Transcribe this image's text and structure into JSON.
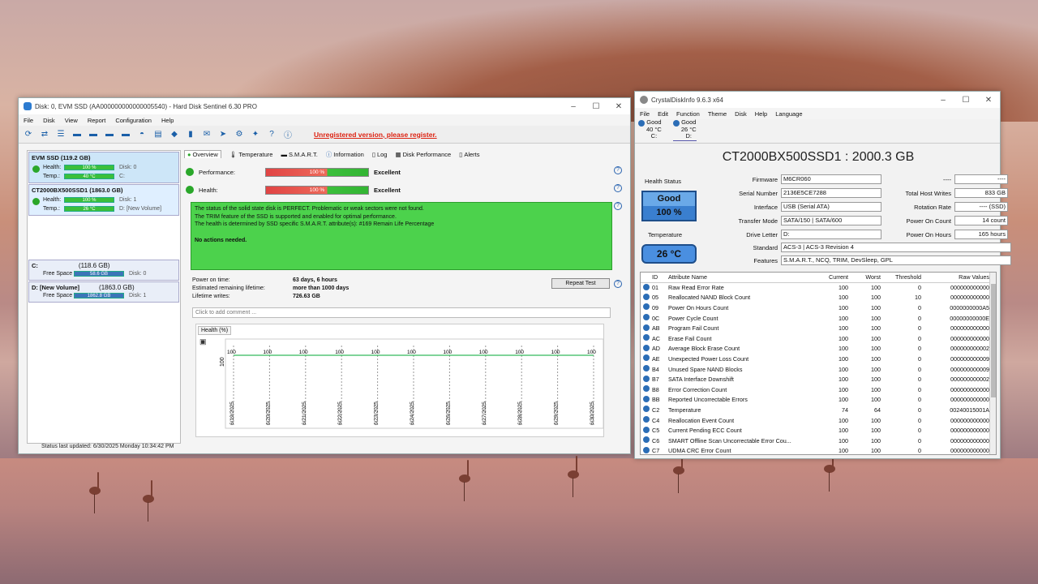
{
  "hds": {
    "title": "Disk: 0, EVM SSD (AA000000000000005540) - Hard Disk Sentinel 6.30 PRO",
    "menu": [
      "File",
      "Disk",
      "View",
      "Report",
      "Configuration",
      "Help"
    ],
    "unregistered": "Unregistered version, please register.",
    "disks": [
      {
        "name": "EVM SSD (119.2 GB)",
        "health_label": "Health:",
        "health": "100 %",
        "disk_label": "Disk: 0",
        "temp_label": "Temp.:",
        "temp": "40 °C",
        "temp_side": "C:"
      },
      {
        "name": "CT2000BX500SSD1 (1863.0 GB)",
        "health_label": "Health:",
        "health": "100 %",
        "disk_label": "Disk: 1",
        "temp_label": "Temp.:",
        "temp": "26 °C",
        "temp_side": "D: [New Volume]"
      }
    ],
    "volumes": [
      {
        "name": "C:",
        "size": "(118.6 GB)",
        "free_label": "Free Space",
        "free": "58.6 GB",
        "disk": "Disk: 0"
      },
      {
        "name": "D: [New Volume]",
        "size": "(1863.0 GB)",
        "free_label": "Free Space",
        "free": "1862.8 GB",
        "disk": "Disk: 1"
      }
    ],
    "tabs": [
      "Overview",
      "Temperature",
      "S.M.A.R.T.",
      "Information",
      "Log",
      "Disk Performance",
      "Alerts"
    ],
    "performance": {
      "label": "Performance:",
      "value": "100 %",
      "status": "Excellent"
    },
    "health": {
      "label": "Health:",
      "value": "100 %",
      "status": "Excellent"
    },
    "status_lines": [
      "The status of the solid state disk is PERFECT. Problematic or weak sectors were not found.",
      "The TRIM feature of the SSD is supported and enabled for optimal performance.",
      "The health is determined by SSD specific S.M.A.R.T. attribute(s): #169 Remain Life Percentage",
      "No actions needed."
    ],
    "power_on_label": "Power on time:",
    "power_on": "63 days, 6 hours",
    "remaining_label": "Estimated remaining lifetime:",
    "remaining": "more than 1000 days",
    "writes_label": "Lifetime writes:",
    "writes": "726.63 GB",
    "repeat_test": "Repeat Test",
    "comment_placeholder": "Click to add comment ...",
    "chart_tab": "Health (%)",
    "statusbar": "Status last updated: 6/30/2025 Monday 10:34:42 PM"
  },
  "chart_data": {
    "type": "line",
    "title": "Health (%)",
    "ylabel": "100",
    "x": [
      "6/19/2025",
      "6/20/2025",
      "6/21/2025",
      "6/22/2025",
      "6/23/2025",
      "6/24/2025",
      "6/26/2025",
      "6/27/2025",
      "6/28/2025",
      "6/29/2025",
      "6/30/2025"
    ],
    "values": [
      100,
      100,
      100,
      100,
      100,
      100,
      100,
      100,
      100,
      100,
      100
    ],
    "ylim": [
      0,
      100
    ]
  },
  "cdi": {
    "title": "CrystalDiskInfo 9.6.3 x64",
    "menu": [
      "File",
      "Edit",
      "Function",
      "Theme",
      "Disk",
      "Help",
      "Language"
    ],
    "drives": [
      {
        "status": "Good",
        "temp": "40 °C",
        "letter": "C:"
      },
      {
        "status": "Good",
        "temp": "26 °C",
        "letter": "D:"
      }
    ],
    "model": "CT2000BX500SSD1 : 2000.3 GB",
    "health_status_label": "Health Status",
    "health_word": "Good",
    "health_pct": "100 %",
    "temperature_label": "Temperature",
    "temperature": "26 °C",
    "firmware_label": "Firmware",
    "firmware": "M6CR060",
    "serial_label": "Serial Number",
    "serial": "2136E5CE7288",
    "interface_label": "Interface",
    "interface": "USB (Serial ATA)",
    "transfer_label": "Transfer Mode",
    "transfer": "SATA/150 | SATA/600",
    "drive_letter_label": "Drive Letter",
    "drive_letter": "D:",
    "standard_label": "Standard",
    "standard": "ACS-3 | ACS-3 Revision 4",
    "features_label": "Features",
    "features": "S.M.A.R.T., NCQ, TRIM, DevSleep, GPL",
    "blank_right_1_label": "----",
    "blank_right_1": "----",
    "host_writes_label": "Total Host Writes",
    "host_writes": "833 GB",
    "rotation_label": "Rotation Rate",
    "rotation": "---- (SSD)",
    "power_count_label": "Power On Count",
    "power_count": "14 count",
    "power_hours_label": "Power On Hours",
    "power_hours": "165 hours",
    "smart_headers": [
      "ID",
      "Attribute Name",
      "Current",
      "Worst",
      "Threshold",
      "Raw Values"
    ],
    "smart_rows": [
      [
        "01",
        "Raw Read Error Rate",
        "100",
        "100",
        "0",
        "000000000000"
      ],
      [
        "05",
        "Reallocated NAND Block Count",
        "100",
        "100",
        "10",
        "000000000000"
      ],
      [
        "09",
        "Power On Hours Count",
        "100",
        "100",
        "0",
        "0000000000A5"
      ],
      [
        "0C",
        "Power Cycle Count",
        "100",
        "100",
        "0",
        "00000000000E"
      ],
      [
        "AB",
        "Program Fail Count",
        "100",
        "100",
        "0",
        "000000000000"
      ],
      [
        "AC",
        "Erase Fail Count",
        "100",
        "100",
        "0",
        "000000000000"
      ],
      [
        "AD",
        "Average Block Erase Count",
        "100",
        "100",
        "0",
        "000000000002"
      ],
      [
        "AE",
        "Unexpected Power Loss Count",
        "100",
        "100",
        "0",
        "000000000009"
      ],
      [
        "B4",
        "Unused Spare NAND Blocks",
        "100",
        "100",
        "0",
        "000000000009"
      ],
      [
        "B7",
        "SATA Interface Downshift",
        "100",
        "100",
        "0",
        "000000000002"
      ],
      [
        "B8",
        "Error Correction Count",
        "100",
        "100",
        "0",
        "000000000000"
      ],
      [
        "BB",
        "Reported Uncorrectable Errors",
        "100",
        "100",
        "0",
        "000000000000"
      ],
      [
        "C2",
        "Temperature",
        "74",
        "64",
        "0",
        "00240015001A"
      ],
      [
        "C4",
        "Reallocation Event Count",
        "100",
        "100",
        "0",
        "000000000000"
      ],
      [
        "C5",
        "Current Pending ECC Count",
        "100",
        "100",
        "0",
        "000000000000"
      ],
      [
        "C6",
        "SMART Offline Scan Uncorrectable Error Cou...",
        "100",
        "100",
        "0",
        "000000000000"
      ],
      [
        "C7",
        "UDMA CRC Error Count",
        "100",
        "100",
        "0",
        "000000000000"
      ]
    ]
  }
}
